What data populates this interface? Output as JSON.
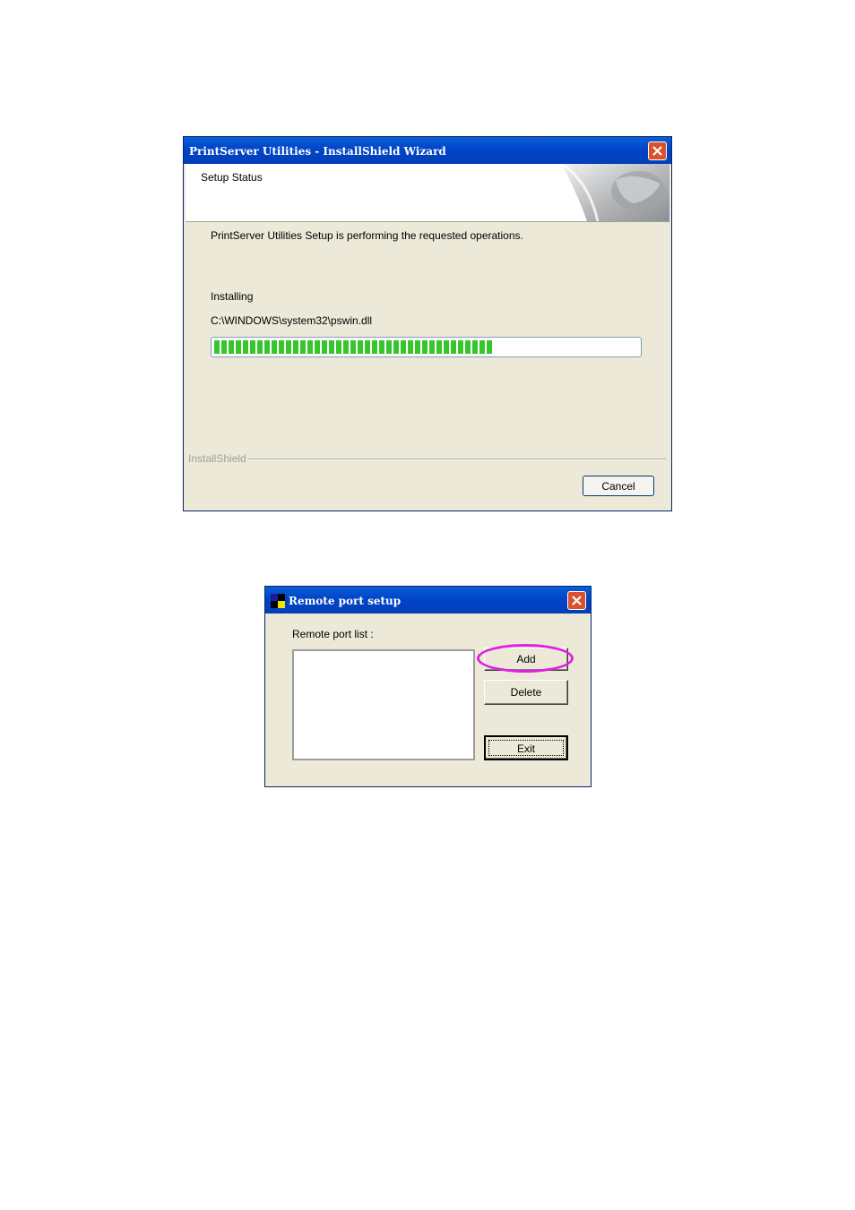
{
  "wizard": {
    "title": "PrintServer Utilities - InstallShield Wizard",
    "header_title": "Setup Status",
    "message": "PrintServer Utilities Setup is performing the requested operations.",
    "status": "Installing",
    "file_path": "C:\\WINDOWS\\system32\\pswin.dll",
    "progress_fraction": 0.66,
    "brand": "InstallShield",
    "cancel_label": "Cancel"
  },
  "remote_port": {
    "title": "Remote port setup",
    "list_label": "Remote port list :",
    "list_items": [],
    "add_label": "Add",
    "delete_label": "Delete",
    "exit_label": "Exit",
    "highlight_color": "#e020e0"
  },
  "icons": [
    "close-icon",
    "app-icon",
    "wizard-graphic"
  ]
}
